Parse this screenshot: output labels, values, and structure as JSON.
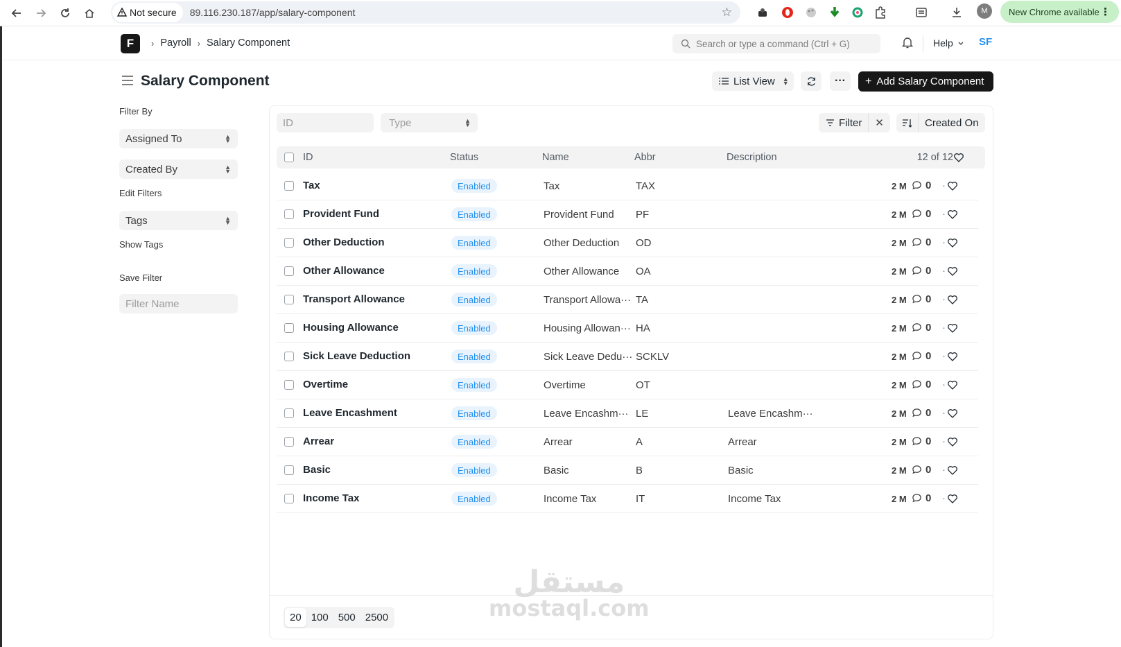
{
  "browser": {
    "security_label": "Not secure",
    "url": "89.116.230.187/app/salary-component",
    "profile_initial": "M",
    "update_label": "New Chrome available"
  },
  "navbar": {
    "logo_letter": "F",
    "breadcrumbs": [
      "Payroll",
      "Salary Component"
    ],
    "search_placeholder": "Search or type a command (Ctrl + G)",
    "help_label": "Help",
    "user_initials": "SF"
  },
  "header": {
    "title": "Salary Component",
    "view_label": "List View",
    "add_label": "Add Salary Component"
  },
  "sidebar": {
    "filter_by_label": "Filter By",
    "assigned_to_label": "Assigned To",
    "created_by_label": "Created By",
    "edit_filters_label": "Edit Filters",
    "tags_label": "Tags",
    "show_tags_label": "Show Tags",
    "save_filter_label": "Save Filter",
    "filter_name_placeholder": "Filter Name"
  },
  "filters": {
    "id_placeholder": "ID",
    "type_placeholder": "Type",
    "filter_label": "Filter",
    "sort_label": "Created On"
  },
  "table": {
    "columns": [
      "ID",
      "Status",
      "Name",
      "Abbr",
      "Description"
    ],
    "count": "12 of 12",
    "rows": [
      {
        "id": "Tax",
        "status": "Enabled",
        "name": "Tax",
        "abbr": "TAX",
        "description": "",
        "time": "2 M",
        "comments": "0"
      },
      {
        "id": "Provident Fund",
        "status": "Enabled",
        "name": "Provident Fund",
        "abbr": "PF",
        "description": "",
        "time": "2 M",
        "comments": "0"
      },
      {
        "id": "Other Deduction",
        "status": "Enabled",
        "name": "Other Deduction",
        "abbr": "OD",
        "description": "",
        "time": "2 M",
        "comments": "0"
      },
      {
        "id": "Other Allowance",
        "status": "Enabled",
        "name": "Other Allowance",
        "abbr": "OA",
        "description": "",
        "time": "2 M",
        "comments": "0"
      },
      {
        "id": "Transport Allowance",
        "status": "Enabled",
        "name": "Transport Allowa···",
        "abbr": "TA",
        "description": "",
        "time": "2 M",
        "comments": "0"
      },
      {
        "id": "Housing Allowance",
        "status": "Enabled",
        "name": "Housing Allowan···",
        "abbr": "HA",
        "description": "",
        "time": "2 M",
        "comments": "0"
      },
      {
        "id": "Sick Leave Deduction",
        "status": "Enabled",
        "name": "Sick Leave Dedu···",
        "abbr": "SCKLV",
        "description": "",
        "time": "2 M",
        "comments": "0"
      },
      {
        "id": "Overtime",
        "status": "Enabled",
        "name": "Overtime",
        "abbr": "OT",
        "description": "",
        "time": "2 M",
        "comments": "0"
      },
      {
        "id": "Leave Encashment",
        "status": "Enabled",
        "name": "Leave Encashm···",
        "abbr": "LE",
        "description": "Leave Encashm···",
        "time": "2 M",
        "comments": "0"
      },
      {
        "id": "Arrear",
        "status": "Enabled",
        "name": "Arrear",
        "abbr": "A",
        "description": "Arrear",
        "time": "2 M",
        "comments": "0"
      },
      {
        "id": "Basic",
        "status": "Enabled",
        "name": "Basic",
        "abbr": "B",
        "description": "Basic",
        "time": "2 M",
        "comments": "0"
      },
      {
        "id": "Income Tax",
        "status": "Enabled",
        "name": "Income Tax",
        "abbr": "IT",
        "description": "Income Tax",
        "time": "2 M",
        "comments": "0"
      }
    ]
  },
  "pagination": {
    "sizes": [
      "20",
      "100",
      "500",
      "2500"
    ]
  },
  "watermark": {
    "arabic": "مستقل",
    "latin": "mostaql.com"
  },
  "colors": {
    "primary_dark": "#171717",
    "status_blue": "#2490ef",
    "status_bg": "#e8f3fd",
    "update_green": "#c7f0c8"
  }
}
